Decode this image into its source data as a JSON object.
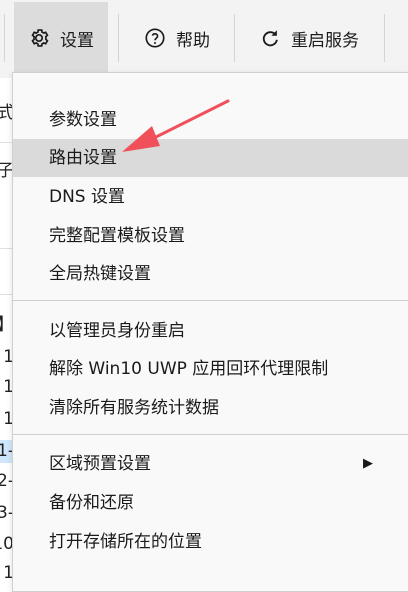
{
  "toolbar": {
    "settings_label": "设置",
    "help_label": "帮助",
    "restart_label": "重启服务"
  },
  "background": {
    "row_fragments": [
      "式",
      "子",
      "】",
      "1",
      "1",
      "1",
      "1-",
      "2-",
      "3-",
      "10",
      "1"
    ]
  },
  "menu": {
    "items": [
      {
        "label": "参数设置"
      },
      {
        "label": "路由设置"
      },
      {
        "label": "DNS 设置"
      },
      {
        "label": "完整配置模板设置"
      },
      {
        "label": "全局热键设置"
      },
      {
        "label": "以管理员身份重启"
      },
      {
        "label": "解除 Win10 UWP 应用回环代理限制"
      },
      {
        "label": "清除所有服务统计数据"
      },
      {
        "label": "区域预置设置"
      },
      {
        "label": "备份和还原"
      },
      {
        "label": "打开存储所在的位置"
      }
    ],
    "submenu_arrow": "▶"
  },
  "colors": {
    "annotation_arrow": "#f0505a",
    "hover_bg": "#dadada",
    "toolbar_bg": "#f3f3f3"
  }
}
